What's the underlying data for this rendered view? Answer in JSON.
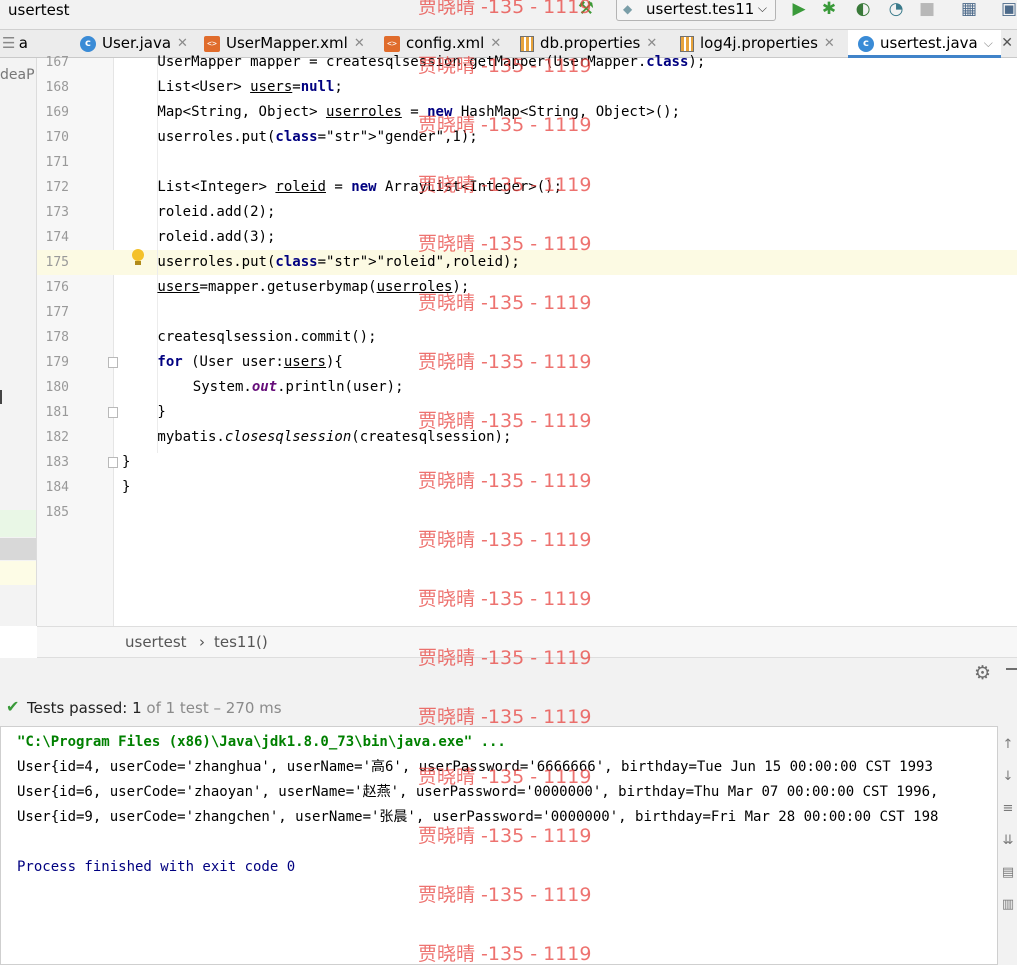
{
  "toolbar": {
    "project": "usertest",
    "run_config": "usertest.tes11"
  },
  "tabs": [
    {
      "label": "a",
      "icon": "none"
    },
    {
      "label": "User.java",
      "icon": "java-class"
    },
    {
      "label": "UserMapper.xml",
      "icon": "xml"
    },
    {
      "label": "config.xml",
      "icon": "xml"
    },
    {
      "label": "db.properties",
      "icon": "properties"
    },
    {
      "label": "log4j.properties",
      "icon": "properties"
    },
    {
      "label": "usertest.java",
      "icon": "java-class",
      "active": true
    }
  ],
  "left_strip": {
    "fragment": "deaP"
  },
  "editor": {
    "lines": [
      {
        "n": "167",
        "code": "UserMapper mapper = createsqlsession.getMapper(UserMapper.class);"
      },
      {
        "n": "168",
        "code": "List<User> users=null;"
      },
      {
        "n": "169",
        "code": "Map<String, Object> userroles = new HashMap<String, Object>();"
      },
      {
        "n": "170",
        "code": "userroles.put(\"gender\",1);"
      },
      {
        "n": "171",
        "code": ""
      },
      {
        "n": "172",
        "code": "List<Integer> roleid = new ArrayList<Integer>();"
      },
      {
        "n": "173",
        "code": "roleid.add(2);"
      },
      {
        "n": "174",
        "code": "roleid.add(3);"
      },
      {
        "n": "175",
        "code": "userroles.put(\"roleid\",roleid);"
      },
      {
        "n": "176",
        "code": "users=mapper.getuserbymap(userroles);"
      },
      {
        "n": "177",
        "code": ""
      },
      {
        "n": "178",
        "code": "createsqlsession.commit();"
      },
      {
        "n": "179",
        "code": "for (User user:users){"
      },
      {
        "n": "180",
        "code": "System.out.println(user);"
      },
      {
        "n": "181",
        "code": "}"
      },
      {
        "n": "182",
        "code": "mybatis.closesqlsession(createsqlsession);"
      },
      {
        "n": "183",
        "code": "}"
      },
      {
        "n": "184",
        "code": "}"
      },
      {
        "n": "185",
        "code": ""
      }
    ]
  },
  "breadcrumb": {
    "class": "usertest",
    "sep": "›",
    "method": "tes11()"
  },
  "run": {
    "status_label": "Tests passed:",
    "status_count": "1",
    "status_detail": "of 1 test – 270 ms",
    "console": [
      {
        "type": "cmd",
        "text": "\"C:\\Program Files (x86)\\Java\\jdk1.8.0_73\\bin\\java.exe\" ..."
      },
      {
        "type": "out",
        "text": "User{id=4, userCode='zhanghua', userName='高6', userPassword='6666666', birthday=Tue Jun 15 00:00:00 CST 1993"
      },
      {
        "type": "out",
        "text": "User{id=6, userCode='zhaoyan', userName='赵燕', userPassword='0000000', birthday=Thu Mar 07 00:00:00 CST 1996,"
      },
      {
        "type": "out",
        "text": "User{id=9, userCode='zhangchen', userName='张晨', userPassword='0000000', birthday=Fri Mar 28 00:00:00 CST 198"
      },
      {
        "type": "blank",
        "text": ""
      },
      {
        "type": "proc",
        "text": "Process finished with exit code 0"
      }
    ]
  },
  "watermark": {
    "text": "贾晓晴 -135 - 1119",
    "color": "#e8433f"
  }
}
